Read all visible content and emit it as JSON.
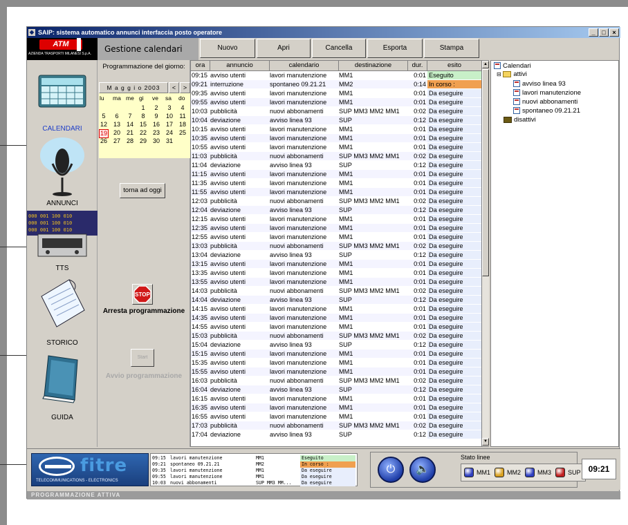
{
  "window": {
    "title": "SAIP: sistema automatico annunci interfaccia posto operatore",
    "controls": [
      "_",
      "□",
      "×"
    ]
  },
  "logo": {
    "name": "ATM",
    "subtitle": "AZIENDA TRASPORTI MILANESI S.p.A."
  },
  "header": {
    "section": "Gestione calendari"
  },
  "toolbar": {
    "nuovo": "Nuovo",
    "apri": "Apri",
    "cancella": "Cancella",
    "esporta": "Esporta",
    "stampa": "Stampa"
  },
  "nav": {
    "calendari": "CALENDARI",
    "annunci": "ANNUNCI",
    "tts": "TTS",
    "storico": "STORICO",
    "guida": "GUIDA"
  },
  "calendar": {
    "title": "Programmazione del giorno:",
    "month": "M a g g i o 2003",
    "prev": "<",
    "next": ">",
    "weekdays": [
      "lu",
      "ma",
      "me",
      "gi",
      "ve",
      "sa",
      "do"
    ],
    "days": [
      "1",
      "2",
      "3",
      "4",
      "5",
      "6",
      "7",
      "8",
      "9",
      "10",
      "11",
      "12",
      "13",
      "14",
      "15",
      "16",
      "17",
      "18",
      "19",
      "20",
      "21",
      "22",
      "23",
      "24",
      "25",
      "26",
      "27",
      "28",
      "29",
      "30",
      "31"
    ],
    "first_weekday_index": 3,
    "today": "19",
    "today_button": "torna ad oggi",
    "stop_icon": "STOP",
    "stop_label": "Arresta programmazione",
    "start_icon": "Start",
    "start_label": "Avvio programmazione"
  },
  "grid": {
    "columns": [
      "ora",
      "annuncio",
      "calendario",
      "destinazione",
      "dur.",
      "esito"
    ],
    "rows": [
      [
        "09:15",
        "avviso utenti",
        "lavori manutenzione",
        "MM1",
        "0:01",
        "Eseguito"
      ],
      [
        "09:21",
        "interruzione",
        "spontaneo 09.21.21",
        "MM2",
        "0:14",
        "In corso :"
      ],
      [
        "09:35",
        "avviso utenti",
        "lavori manutenzione",
        "MM1",
        "0:01",
        "Da eseguire"
      ],
      [
        "09:55",
        "avviso utenti",
        "lavori manutenzione",
        "MM1",
        "0:01",
        "Da eseguire"
      ],
      [
        "10:03",
        "pubblicità",
        "nuovi abbonamenti",
        "SUP MM3 MM2 MM1",
        "0:02",
        "Da eseguire"
      ],
      [
        "10:04",
        "deviazione",
        "avviso linea 93",
        "SUP",
        "0:12",
        "Da eseguire"
      ],
      [
        "10:15",
        "avviso utenti",
        "lavori manutenzione",
        "MM1",
        "0:01",
        "Da eseguire"
      ],
      [
        "10:35",
        "avviso utenti",
        "lavori manutenzione",
        "MM1",
        "0:01",
        "Da eseguire"
      ],
      [
        "10:55",
        "avviso utenti",
        "lavori manutenzione",
        "MM1",
        "0:01",
        "Da eseguire"
      ],
      [
        "11:03",
        "pubblicità",
        "nuovi abbonamenti",
        "SUP MM3 MM2 MM1",
        "0:02",
        "Da eseguire"
      ],
      [
        "11:04",
        "deviazione",
        "avviso linea 93",
        "SUP",
        "0:12",
        "Da eseguire"
      ],
      [
        "11:15",
        "avviso utenti",
        "lavori manutenzione",
        "MM1",
        "0:01",
        "Da eseguire"
      ],
      [
        "11:35",
        "avviso utenti",
        "lavori manutenzione",
        "MM1",
        "0:01",
        "Da eseguire"
      ],
      [
        "11:55",
        "avviso utenti",
        "lavori manutenzione",
        "MM1",
        "0:01",
        "Da eseguire"
      ],
      [
        "12:03",
        "pubblicità",
        "nuovi abbonamenti",
        "SUP MM3 MM2 MM1",
        "0:02",
        "Da eseguire"
      ],
      [
        "12:04",
        "deviazione",
        "avviso linea 93",
        "SUP",
        "0:12",
        "Da eseguire"
      ],
      [
        "12:15",
        "avviso utenti",
        "lavori manutenzione",
        "MM1",
        "0:01",
        "Da eseguire"
      ],
      [
        "12:35",
        "avviso utenti",
        "lavori manutenzione",
        "MM1",
        "0:01",
        "Da eseguire"
      ],
      [
        "12:55",
        "avviso utenti",
        "lavori manutenzione",
        "MM1",
        "0:01",
        "Da eseguire"
      ],
      [
        "13:03",
        "pubblicità",
        "nuovi abbonamenti",
        "SUP MM3 MM2 MM1",
        "0:02",
        "Da eseguire"
      ],
      [
        "13:04",
        "deviazione",
        "avviso linea 93",
        "SUP",
        "0:12",
        "Da eseguire"
      ],
      [
        "13:15",
        "avviso utenti",
        "lavori manutenzione",
        "MM1",
        "0:01",
        "Da eseguire"
      ],
      [
        "13:35",
        "avviso utenti",
        "lavori manutenzione",
        "MM1",
        "0:01",
        "Da eseguire"
      ],
      [
        "13:55",
        "avviso utenti",
        "lavori manutenzione",
        "MM1",
        "0:01",
        "Da eseguire"
      ],
      [
        "14:03",
        "pubblicità",
        "nuovi abbonamenti",
        "SUP MM3 MM2 MM1",
        "0:02",
        "Da eseguire"
      ],
      [
        "14:04",
        "deviazione",
        "avviso linea 93",
        "SUP",
        "0:12",
        "Da eseguire"
      ],
      [
        "14:15",
        "avviso utenti",
        "lavori manutenzione",
        "MM1",
        "0:01",
        "Da eseguire"
      ],
      [
        "14:35",
        "avviso utenti",
        "lavori manutenzione",
        "MM1",
        "0:01",
        "Da eseguire"
      ],
      [
        "14:55",
        "avviso utenti",
        "lavori manutenzione",
        "MM1",
        "0:01",
        "Da eseguire"
      ],
      [
        "15:03",
        "pubblicità",
        "nuovi abbonamenti",
        "SUP MM3 MM2 MM1",
        "0:02",
        "Da eseguire"
      ],
      [
        "15:04",
        "deviazione",
        "avviso linea 93",
        "SUP",
        "0:12",
        "Da eseguire"
      ],
      [
        "15:15",
        "avviso utenti",
        "lavori manutenzione",
        "MM1",
        "0:01",
        "Da eseguire"
      ],
      [
        "15:35",
        "avviso utenti",
        "lavori manutenzione",
        "MM1",
        "0:01",
        "Da eseguire"
      ],
      [
        "15:55",
        "avviso utenti",
        "lavori manutenzione",
        "MM1",
        "0:01",
        "Da eseguire"
      ],
      [
        "16:03",
        "pubblicità",
        "nuovi abbonamenti",
        "SUP MM3 MM2 MM1",
        "0:02",
        "Da eseguire"
      ],
      [
        "16:04",
        "deviazione",
        "avviso linea 93",
        "SUP",
        "0:12",
        "Da eseguire"
      ],
      [
        "16:15",
        "avviso utenti",
        "lavori manutenzione",
        "MM1",
        "0:01",
        "Da eseguire"
      ],
      [
        "16:35",
        "avviso utenti",
        "lavori manutenzione",
        "MM1",
        "0:01",
        "Da eseguire"
      ],
      [
        "16:55",
        "avviso utenti",
        "lavori manutenzione",
        "MM1",
        "0:01",
        "Da eseguire"
      ],
      [
        "17:03",
        "pubblicità",
        "nuovi abbonamenti",
        "SUP MM3 MM2 MM1",
        "0:02",
        "Da eseguire"
      ],
      [
        "17:04",
        "deviazione",
        "avviso linea 93",
        "SUP",
        "0:12",
        "Da eseguire"
      ]
    ],
    "status_colors": {
      "Eseguito": "#c8f0c8",
      "In corso :": "#f0a050",
      "Da eseguire": "#e8eefc"
    }
  },
  "tree": {
    "root": "Calendari",
    "attivi": "attivi",
    "items": [
      "avviso linea 93",
      "lavori manutenzione",
      "nuovi abbonamenti",
      "spontaneo 09.21.21"
    ],
    "disattivi": "disattivi"
  },
  "bottom": {
    "brand": "fitre",
    "brand_tagline": "TELECOMMUNICATIONS - ELECTRONICS",
    "mini_rows": [
      [
        "09:15",
        "lavori manutenzione",
        "MM1",
        "Eseguito"
      ],
      [
        "09:21",
        "spontaneo 09.21.21",
        "MM2",
        "In corso :"
      ],
      [
        "09:35",
        "lavori manutenzione",
        "MM1",
        "Da eseguire"
      ],
      [
        "09:55",
        "lavori manutenzione",
        "MM1",
        "Da eseguire"
      ],
      [
        "10:03",
        "nuovi abbonamenti",
        "SUP MM3 MM...",
        "Da eseguire"
      ]
    ],
    "power_icon": "⏻",
    "speaker_icon": "🔈",
    "stato_label": "Stato linee",
    "lines": [
      {
        "name": "MM1",
        "color": "#3040c0"
      },
      {
        "name": "MM2",
        "color": "#d8a020"
      },
      {
        "name": "MM3",
        "color": "#3040c0"
      },
      {
        "name": "SUP",
        "color": "#c02020"
      }
    ],
    "clock": "09:21"
  },
  "statusbar": {
    "text": "PROGRAMMAZIONE ATTIVA"
  }
}
